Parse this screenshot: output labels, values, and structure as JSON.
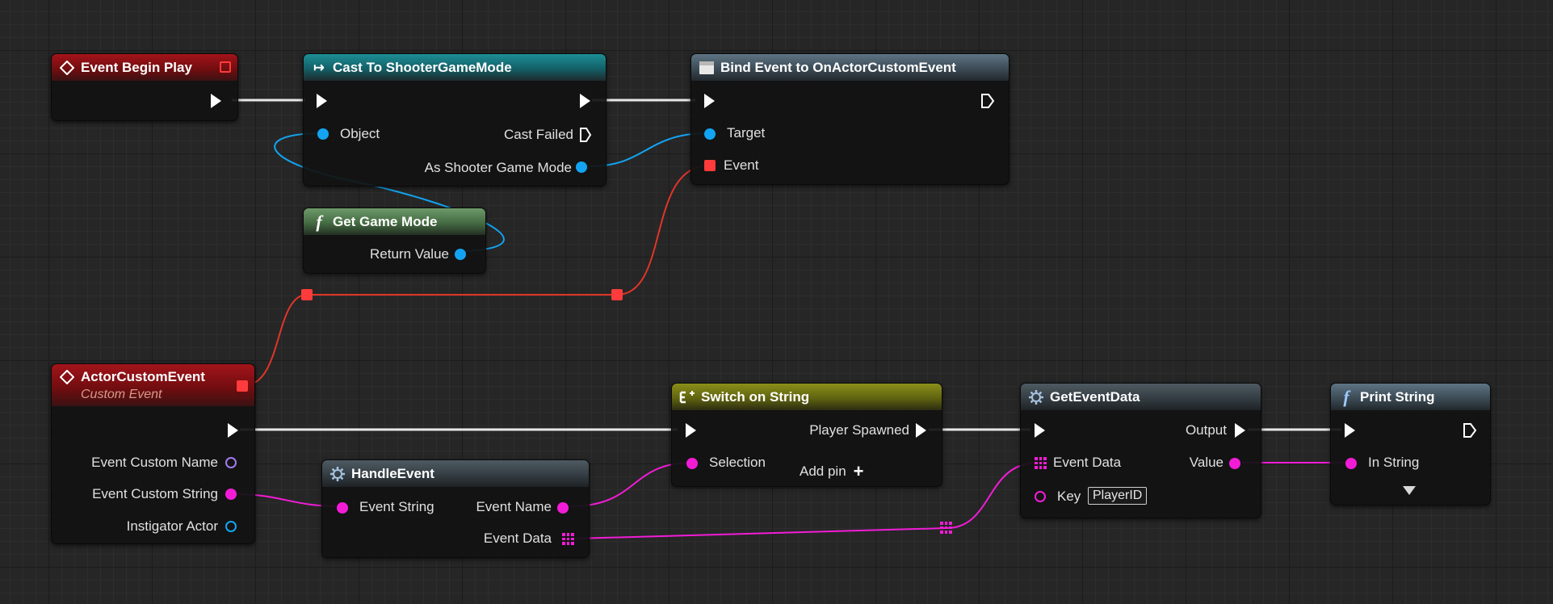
{
  "nodes": {
    "event_begin_play": {
      "title": "Event Begin Play"
    },
    "cast_to": {
      "title": "Cast To ShooterGameMode",
      "object_label": "Object",
      "cast_failed_label": "Cast Failed",
      "as_label": "As Shooter Game Mode"
    },
    "bind_event": {
      "title": "Bind Event to OnActorCustomEvent",
      "target_label": "Target",
      "event_label": "Event"
    },
    "get_game_mode": {
      "title": "Get Game Mode",
      "return_label": "Return Value"
    },
    "actor_custom_event": {
      "title": "ActorCustomEvent",
      "subtitle": "Custom Event",
      "pins": [
        "Event Custom Name",
        "Event Custom String",
        "Instigator Actor"
      ]
    },
    "handle_event": {
      "title": "HandleEvent",
      "event_string_label": "Event String",
      "event_name_label": "Event Name",
      "event_data_label": "Event Data"
    },
    "switch_on_string": {
      "title": "Switch on String",
      "selection_label": "Selection",
      "player_spawned_label": "Player Spawned",
      "add_pin_label": "Add pin"
    },
    "get_event_data": {
      "title": "GetEventData",
      "output_label": "Output",
      "event_data_label": "Event Data",
      "value_label": "Value",
      "key_label": "Key",
      "key_value": "PlayerID"
    },
    "print_string": {
      "title": "Print String",
      "in_string_label": "In String"
    }
  },
  "icons": {
    "event": "event-diamond-icon",
    "cast": "cast-arrow-icon",
    "bind": "bind-event-icon",
    "function": "function-f-icon",
    "macro": "gear-icon",
    "switch": "switch-icon",
    "expand": "chevron-down-icon",
    "add": "plus-icon"
  },
  "colors": {
    "exec": "#ffffff",
    "object": "#12a4f2",
    "delegate": "#ff3b3b",
    "string": "#f21cd7",
    "name": "#a37cf0",
    "event_header": "#a3141a",
    "cast_header": "#1d8e96",
    "function_header": "#6d9a6a",
    "switch_header": "#8b8f1a"
  }
}
